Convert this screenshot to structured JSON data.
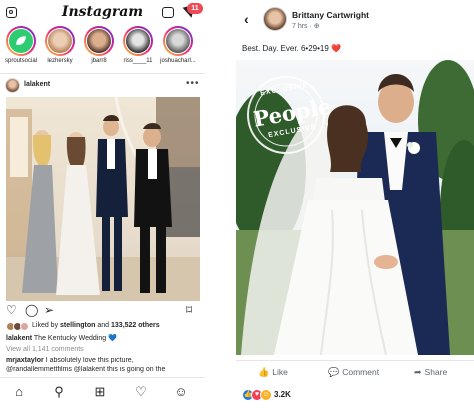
{
  "instagram": {
    "logo": "Instagram",
    "notification_count": "11",
    "stories": [
      {
        "label": "sproutsocial",
        "color": "#2ecc71"
      },
      {
        "label": "lezhersky",
        "color": "#c49a6c"
      },
      {
        "label": "jbarr8",
        "color": "#6b4a3a"
      },
      {
        "label": "riss____11",
        "color": "#3a3a3a"
      },
      {
        "label": "joshuacharl...",
        "color": "#7a7a7a"
      }
    ],
    "post": {
      "username": "lalakent",
      "more": "•••",
      "liked_by_prefix": "Liked by",
      "liked_by_user": "stellington",
      "liked_by_suffix": "and",
      "likes_count": "133,522 others",
      "caption_user": "lalakent",
      "caption_text": "The Kentucky Wedding",
      "caption_emoji": "💙",
      "view_all": "View all 1,141 comments",
      "comment_user": "mrjaxtaylor",
      "comment_text": "I absolutely love this picture,",
      "comment_line2": "@randallemmettfilms @lalakent this is going on the"
    }
  },
  "facebook": {
    "author": "Brittany Cartwright",
    "time": "7 hrs · ",
    "post_text": "Best. Day. Ever. 6•29•19",
    "heart": "❤️",
    "watermark_top": "EXCLUSIVE",
    "watermark_main": "People",
    "watermark_bottom": "EXCLUSIVE",
    "actions": {
      "like": "Like",
      "comment": "Comment",
      "share": "Share"
    },
    "reactions_count": "3.2K"
  },
  "colors": {
    "ig_badge": "#ed4956",
    "fb_text_secondary": "#606770",
    "blue_heart": "#3897f0"
  }
}
